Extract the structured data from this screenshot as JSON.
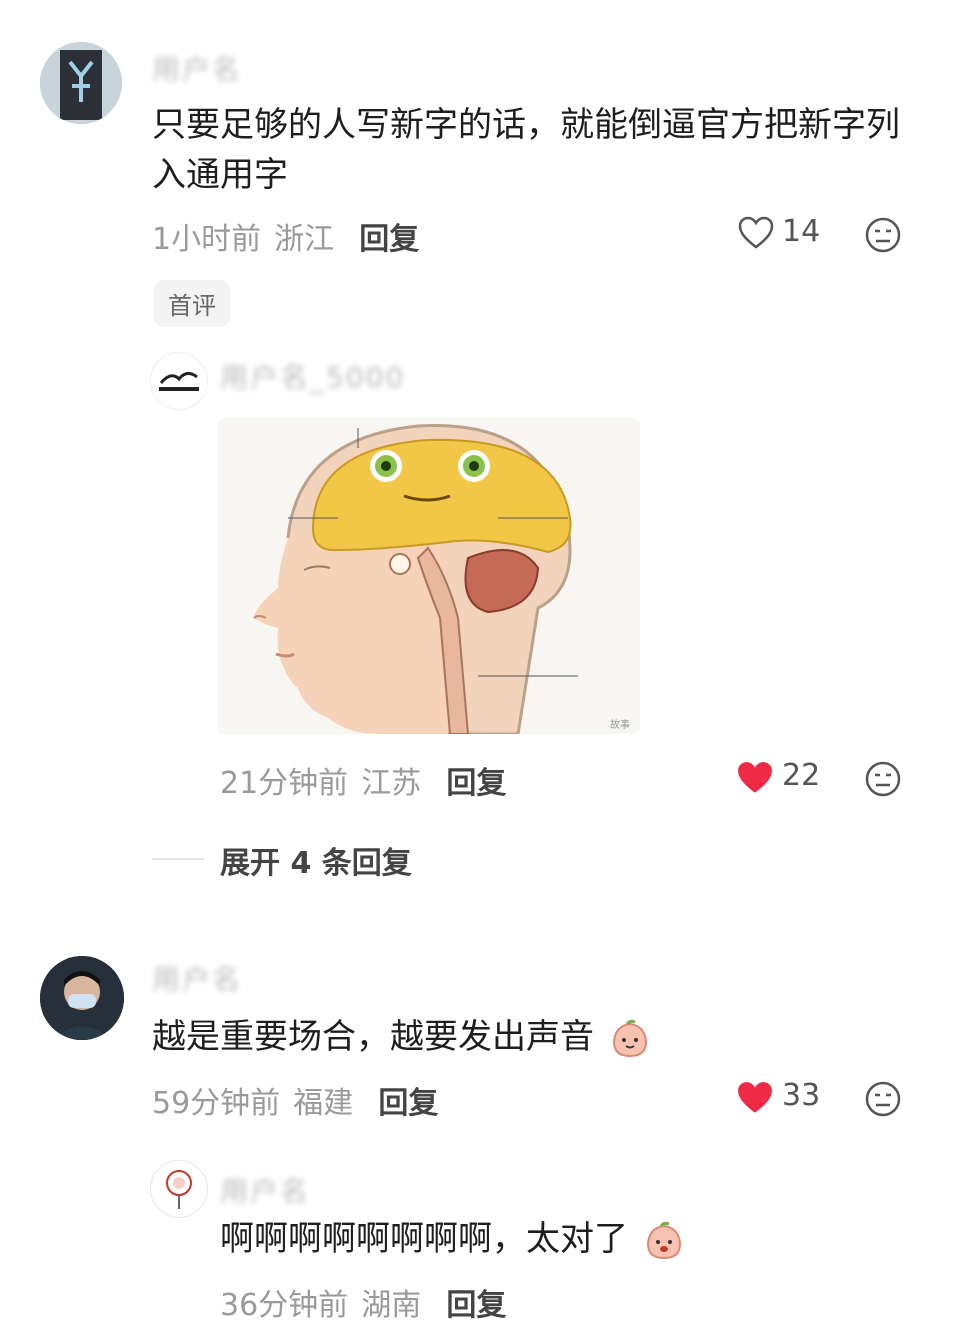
{
  "comments": [
    {
      "username": "用户名",
      "text": "只要足够的人写新字的话，就能倒逼官方把新字列入通用字",
      "time": "1小时前",
      "location": "浙江",
      "reply_label": "回复",
      "likes": "14",
      "liked": false,
      "badge": "首评",
      "replies": [
        {
          "username": "用户名_5000",
          "image_watermark": "故事",
          "time": "21分钟前",
          "location": "江苏",
          "reply_label": "回复",
          "likes": "22",
          "liked": true
        }
      ],
      "expand_label": "展开 4 条回复"
    },
    {
      "username": "用户名",
      "text": "越是重要场合，越要发出声音",
      "time": "59分钟前",
      "location": "福建",
      "reply_label": "回复",
      "likes": "33",
      "liked": true,
      "replies": [
        {
          "username": "用户名",
          "text": "啊啊啊啊啊啊啊啊，太对了",
          "time": "36分钟前",
          "location": "湖南",
          "reply_label": "回复"
        }
      ]
    }
  ],
  "colors": {
    "like_red": "#ee2a44",
    "meta_gray": "#9a9a9a"
  },
  "icons": [
    "heart-outline-icon",
    "heart-filled-icon",
    "emoji-face-icon",
    "peach-emoji-icon"
  ]
}
